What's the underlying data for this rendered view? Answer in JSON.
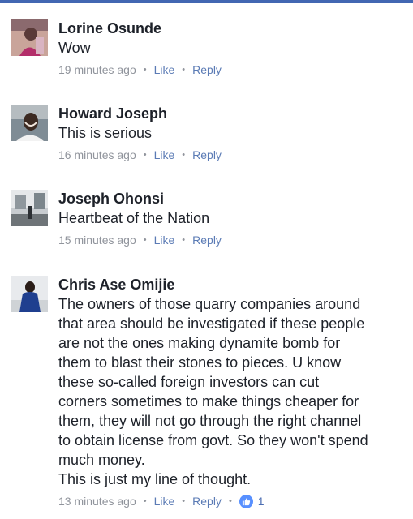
{
  "comments": [
    {
      "name": "Lorine Osunde",
      "text": [
        "Wow"
      ],
      "time": "19 minutes ago",
      "like": "Like",
      "reply": "Reply"
    },
    {
      "name": "Howard Joseph",
      "text": [
        "This is serious"
      ],
      "time": "16 minutes ago",
      "like": "Like",
      "reply": "Reply"
    },
    {
      "name": "Joseph Ohonsi",
      "text": [
        "Heartbeat of the Nation"
      ],
      "time": "15 minutes ago",
      "like": "Like",
      "reply": "Reply"
    },
    {
      "name": "Chris Ase Omijie",
      "text": [
        "The owners of those quarry companies around",
        "that area should be investigated if these people",
        "are not the ones making dynamite bomb for",
        "them to blast their stones to pieces. U know",
        "these so-called foreign investors can cut",
        "corners sometimes to make things cheaper for",
        "them, they will not go through the right channel",
        "to obtain license from govt. So they won't spend",
        "much money.",
        "This is just my line of thought."
      ],
      "time": "13 minutes ago",
      "like": "Like",
      "reply": "Reply",
      "reactions": "1"
    }
  ],
  "colors": {
    "top_bar": "#4267b2",
    "meta": "#90949c",
    "action_link": "#5b7bb5",
    "like_badge": "#5890ff"
  },
  "icons": {
    "reaction": "thumbs-up-icon"
  }
}
